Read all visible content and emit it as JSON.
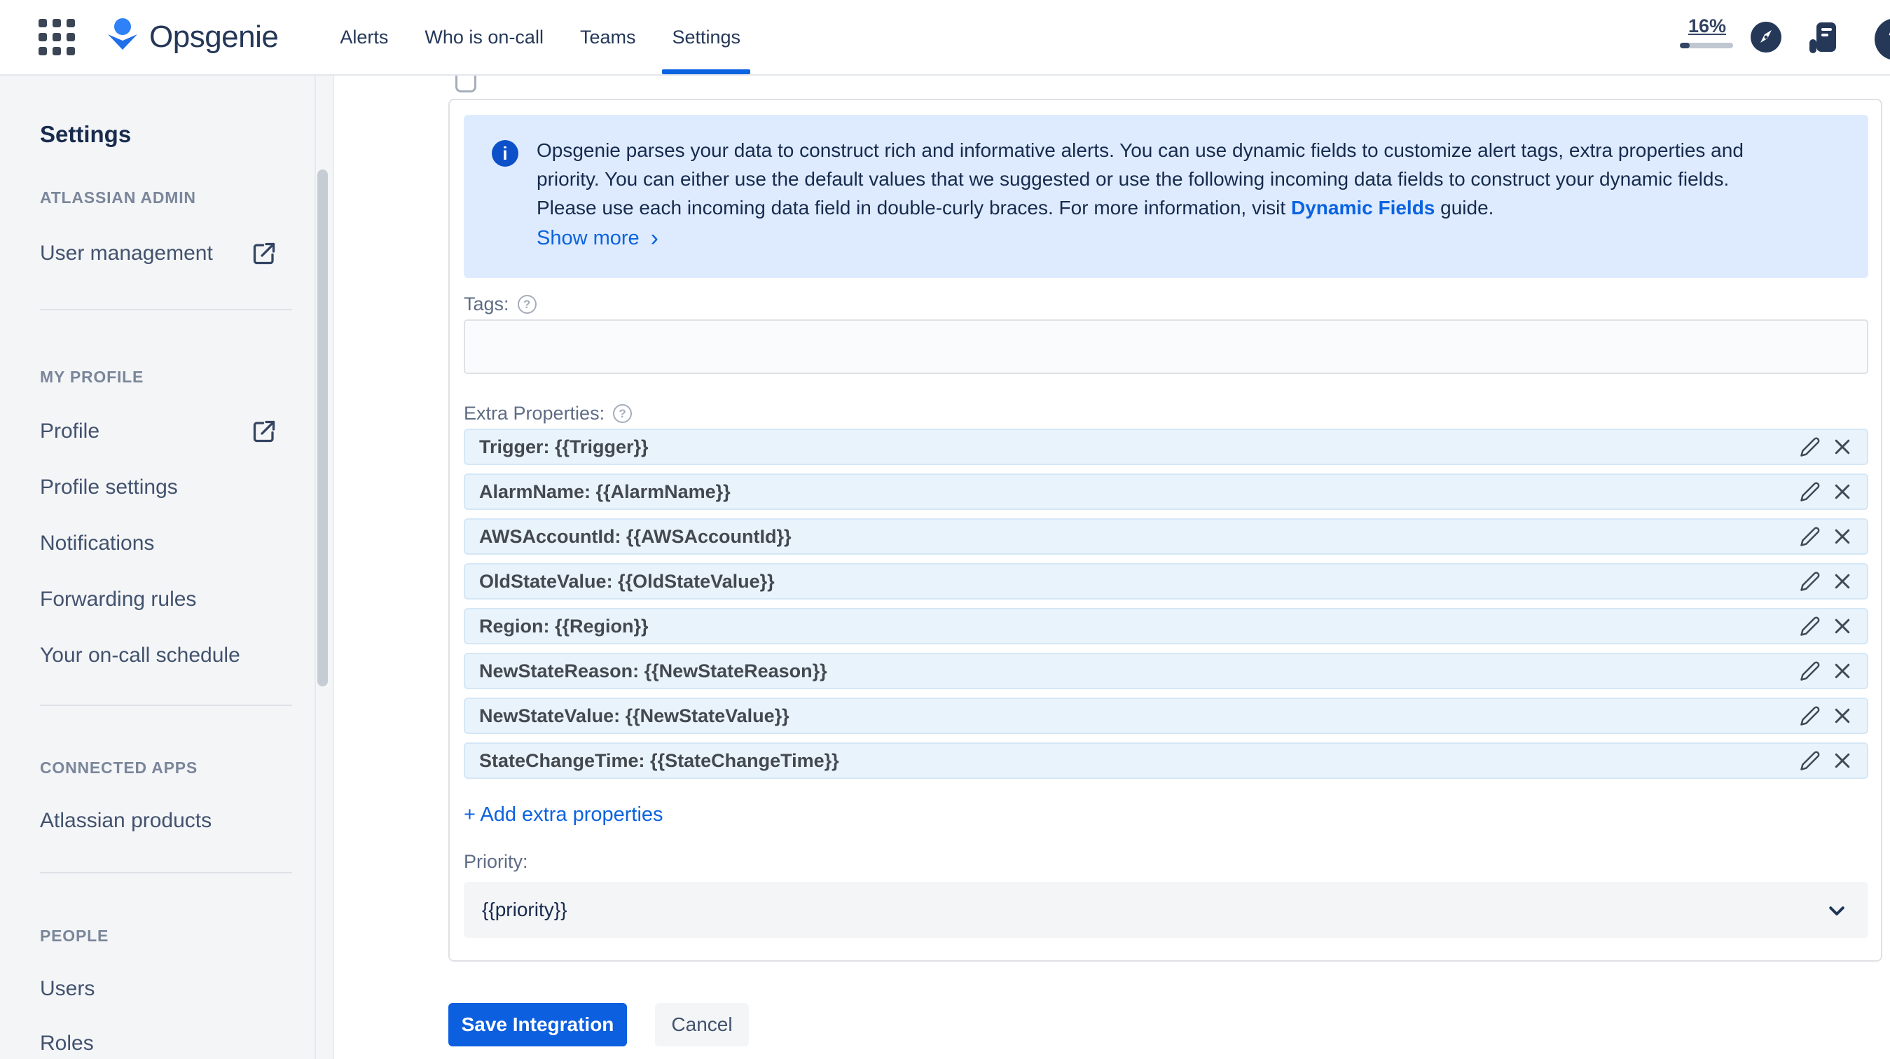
{
  "navbar": {
    "brand": "Opsgenie",
    "items": [
      {
        "label": "Alerts"
      },
      {
        "label": "Who is on-call"
      },
      {
        "label": "Teams"
      },
      {
        "label": "Settings"
      }
    ],
    "usage": {
      "percent": "16%"
    },
    "help_glyph": "?"
  },
  "sidebar": {
    "title": "Settings",
    "sections": [
      {
        "header": "ATLASSIAN ADMIN",
        "items": [
          {
            "label": "User management"
          }
        ]
      },
      {
        "header": "MY PROFILE",
        "items": [
          {
            "label": "Profile"
          },
          {
            "label": "Profile settings"
          },
          {
            "label": "Notifications"
          },
          {
            "label": "Forwarding rules"
          },
          {
            "label": "Your on-call schedule"
          }
        ]
      },
      {
        "header": "CONNECTED APPS",
        "items": [
          {
            "label": "Atlassian products"
          }
        ]
      },
      {
        "header": "PEOPLE",
        "items": [
          {
            "label": "Users"
          },
          {
            "label": "Roles"
          }
        ]
      }
    ]
  },
  "main": {
    "info_banner": {
      "icon_glyph": "i",
      "line1": "Opsgenie parses your data to construct rich and informative alerts. You can use dynamic fields to customize alert tags, extra properties and",
      "line2": "priority. You can either use the default values that we suggested or use the following incoming data fields to construct your dynamic fields.",
      "line3_before": "Please use each incoming data field in double-curly braces. For more information, visit ",
      "link_text": "Dynamic Fields",
      "line3_after": " guide.",
      "show_more": "Show more",
      "show_more_chevron": "›"
    },
    "tags": {
      "label": "Tags:",
      "value": "",
      "help_glyph": "?"
    },
    "extra_properties": {
      "label": "Extra Properties:",
      "help_glyph": "?",
      "rows": [
        "Trigger: {{Trigger}}",
        "AlarmName: {{AlarmName}}",
        "AWSAccountId: {{AWSAccountId}}",
        "OldStateValue: {{OldStateValue}}",
        "Region: {{Region}}",
        "NewStateReason: {{NewStateReason}}",
        "NewStateValue: {{NewStateValue}}",
        "StateChangeTime: {{StateChangeTime}}"
      ],
      "add_link": "+ Add extra properties"
    },
    "priority": {
      "label": "Priority:",
      "value": "{{priority}}"
    },
    "actions": {
      "save": "Save Integration",
      "cancel": "Cancel"
    }
  },
  "colors": {
    "accent_blue": "#0B63E0",
    "navy": "#253858",
    "banner_bg": "#DEEBFF",
    "property_row_bg": "#E9F3FC",
    "save_button_bg": "#0C5FDE",
    "sidebar_bg": "#F4F5F7"
  }
}
